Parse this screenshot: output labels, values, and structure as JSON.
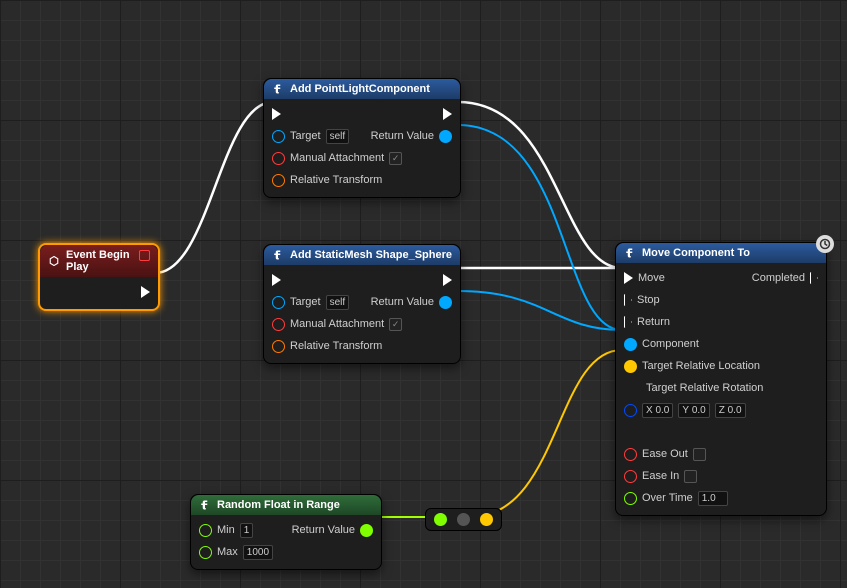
{
  "nodes": {
    "event_begin_play": {
      "title": "Event Begin Play"
    },
    "add_point_light": {
      "title": "Add PointLightComponent",
      "target": "Target",
      "target_value": "self",
      "manual_attachment": "Manual Attachment",
      "relative_transform": "Relative Transform",
      "return_value": "Return Value"
    },
    "add_static_mesh": {
      "title": "Add StaticMesh Shape_Sphere",
      "target": "Target",
      "target_value": "self",
      "manual_attachment": "Manual Attachment",
      "relative_transform": "Relative Transform",
      "return_value": "Return Value"
    },
    "random_float": {
      "title": "Random Float in Range",
      "min": "Min",
      "min_value": "1",
      "max": "Max",
      "max_value": "1000",
      "return_value": "Return Value"
    },
    "move_component": {
      "title": "Move Component To",
      "move": "Move",
      "completed": "Completed",
      "stop": "Stop",
      "return": "Return",
      "component": "Component",
      "target_rel_loc": "Target Relative Location",
      "target_rel_rot": "Target Relative Rotation",
      "rot_x_label": "X",
      "rot_x": "0.0",
      "rot_y_label": "Y",
      "rot_y": "0.0",
      "rot_z_label": "Z",
      "rot_z": "0.0",
      "ease_out": "Ease Out",
      "ease_in": "Ease In",
      "over_time": "Over Time",
      "over_time_value": "1.0"
    }
  }
}
